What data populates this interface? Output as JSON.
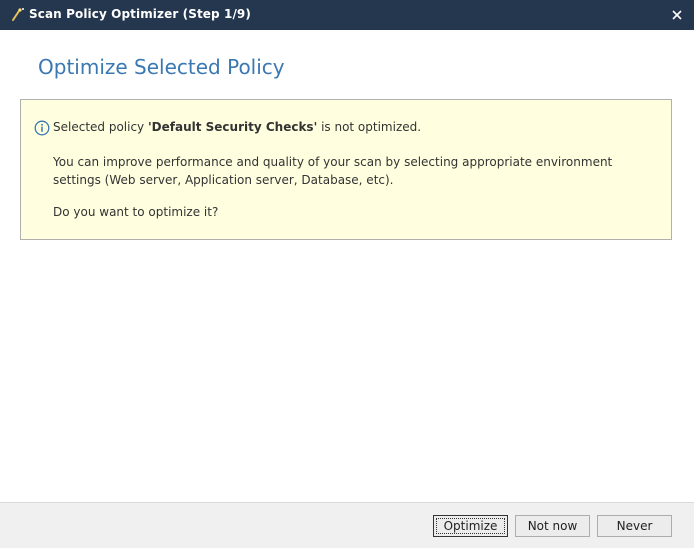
{
  "window": {
    "title": "Scan Policy Optimizer (Step 1/9)",
    "title_icon": "magic-wand-icon",
    "close_icon": "close-icon"
  },
  "page": {
    "title": "Optimize Selected Policy"
  },
  "info": {
    "icon": "info-icon",
    "line1_prefix": "Selected policy ",
    "policy_name": "'Default Security Checks'",
    "line1_suffix": " is not optimized.",
    "paragraph": "You can improve performance and quality of your scan by selecting appropriate environment settings (Web server, Application server, Database, etc).",
    "question": "Do you want to optimize it?"
  },
  "buttons": {
    "optimize": "Optimize",
    "not_now": "Not now",
    "never": "Never"
  },
  "colors": {
    "titlebar_bg": "#25374f",
    "page_title": "#3a78b2",
    "info_bg": "#ffffe0",
    "info_icon": "#3a78b2"
  }
}
